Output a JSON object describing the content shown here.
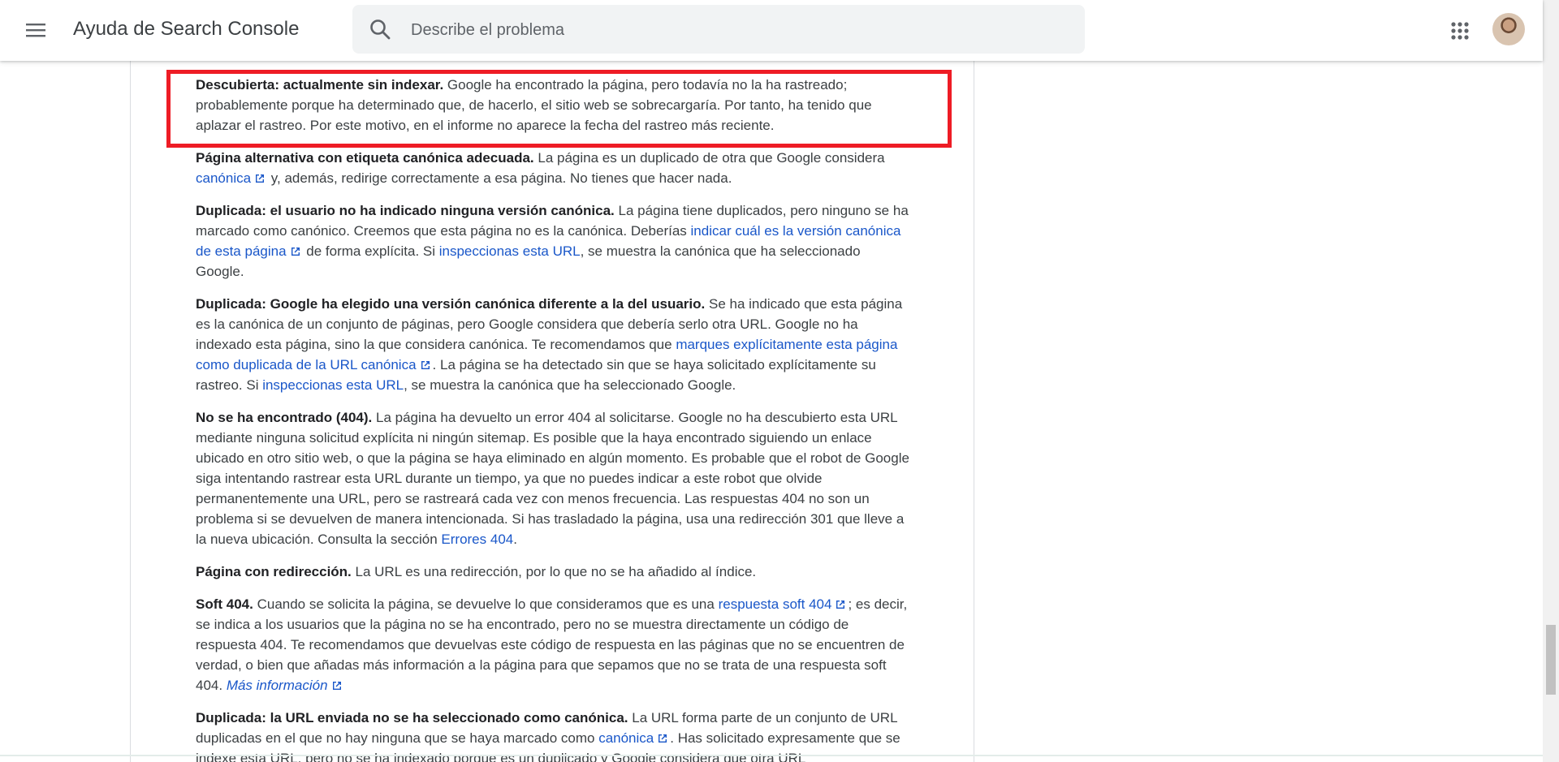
{
  "header": {
    "menu_icon": "menu-icon",
    "title": "Ayuda de Search Console",
    "search_placeholder": "Describe el problema",
    "search_icon": "search-icon",
    "apps_icon": "apps-grid-icon",
    "avatar_icon": "user-avatar"
  },
  "colors": {
    "highlight_border": "#ee1c25",
    "link": "#1a57c9",
    "text": "#3c4043"
  },
  "article": {
    "p1": {
      "term": "Descubierta: actualmente sin indexar.",
      "text": " Google ha encontrado la página, pero todavía no la ha rastreado; probablemente porque ha determinado que, de hacerlo, el sitio web se sobrecargaría. Por tanto, ha tenido que aplazar el rastreo. Por este motivo, en el informe no aparece la fecha del rastreo más reciente."
    },
    "p2": {
      "term": "Página alternativa con etiqueta canónica adecuada.",
      "text1": " La página es un duplicado de otra que Google considera ",
      "link1": "canónica",
      "text2": " y, además, redirige correctamente a esa página. No tienes que hacer nada."
    },
    "p3": {
      "term": "Duplicada: el usuario no ha indicado ninguna versión canónica.",
      "text1": " La página tiene duplicados, pero ninguno se ha marcado como canónico. Creemos que esta página no es la canónica. Deberías ",
      "link1": "indicar cuál es la versión canónica de esta página",
      "text2": " de forma explícita. Si ",
      "link2": "inspeccionas esta URL",
      "text3": ", se muestra la canónica que ha seleccionado Google."
    },
    "p4": {
      "term": "Duplicada: Google ha elegido una versión canónica diferente a la del usuario.",
      "text1": " Se ha indicado que esta página es la canónica de un conjunto de páginas, pero Google considera que debería serlo otra URL. Google no ha indexado esta página, sino la que considera canónica. Te recomendamos que ",
      "link1": "marques explícitamente esta página como duplicada de la URL canónica",
      "text2": ". La página se ha detectado sin que se haya solicitado explícitamente su rastreo. Si ",
      "link2": "inspeccionas esta URL",
      "text3": ", se muestra la canónica que ha seleccionado Google."
    },
    "p5": {
      "term": "No se ha encontrado (404).",
      "text1": " La página ha devuelto un error 404 al solicitarse. Google no ha descubierto esta URL mediante ninguna solicitud explícita ni ningún sitemap. Es posible que la haya encontrado siguiendo un enlace ubicado en otro sitio web, o que la página se haya eliminado en algún momento. Es probable que el robot de Google siga intentando rastrear esta URL durante un tiempo, ya que no puedes indicar a este robot que olvide permanentemente una URL, pero se rastreará cada vez con menos frecuencia. Las respuestas 404 no son un problema si se devuelven de manera intencionada. Si has trasladado la página, usa una redirección 301 que lleve a la nueva ubicación. Consulta la sección ",
      "link1": "Errores 404",
      "text2": "."
    },
    "p6": {
      "term": "Página con redirección.",
      "text": " La URL es una redirección, por lo que no se ha añadido al índice."
    },
    "p7": {
      "term": "Soft 404.",
      "text1": " Cuando se solicita la página, se devuelve lo que consideramos que es una ",
      "link1": "respuesta soft 404",
      "text2": "; es decir, se indica a los usuarios que la página no se ha encontrado, pero no se muestra directamente un código de respuesta 404. Te recomendamos que devuelvas este código de respuesta en las páginas que no se encuentren de verdad, o bien que añadas más información a la página para que sepamos que no se trata de una respuesta soft 404. ",
      "link2": "Más información"
    },
    "p8": {
      "term": "Duplicada: la URL enviada no se ha seleccionado como canónica.",
      "text1": " La URL forma parte de un conjunto de URL duplicadas en el que no hay ninguna que se haya marcado como ",
      "link1": "canónica",
      "text2": ". Has solicitado expresamente que se indexe esta URL, pero no se ha indexado porque es un duplicado y Google considera que otra URL"
    }
  }
}
